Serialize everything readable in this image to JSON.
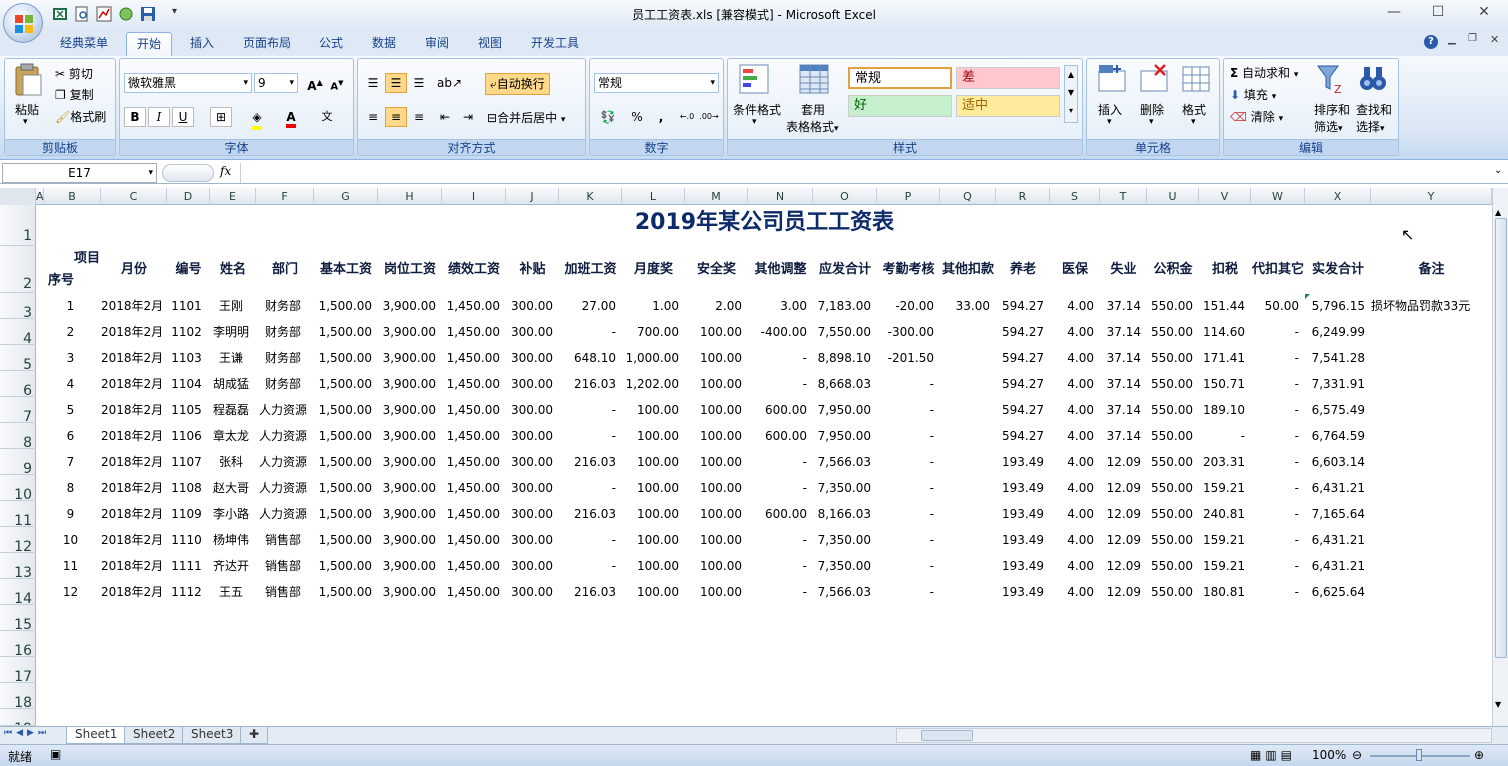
{
  "window": {
    "title": "员工工资表.xls  [兼容模式] - Microsoft Excel"
  },
  "tabs": [
    "经典菜单",
    "开始",
    "插入",
    "页面布局",
    "公式",
    "数据",
    "审阅",
    "视图",
    "开发工具"
  ],
  "ribbon": {
    "clipboard": {
      "label": "剪贴板",
      "paste": "粘贴",
      "cut": "剪切",
      "copy": "复制",
      "format_painter": "格式刷"
    },
    "font": {
      "label": "字体",
      "font_name": "微软雅黑",
      "font_size": "9"
    },
    "alignment": {
      "label": "对齐方式",
      "wrap": "自动换行",
      "merge": "合并后居中"
    },
    "number": {
      "label": "数字",
      "format": "常规",
      "percent": "%",
      "comma": ","
    },
    "styles": {
      "label": "样式",
      "cond": "条件格式",
      "table_line1": "套用",
      "table_line2": "表格格式",
      "normal": "常规",
      "bad": "差",
      "good": "好",
      "neutral": "适中"
    },
    "cells": {
      "label": "单元格",
      "insert": "插入",
      "delete": "删除",
      "format": "格式"
    },
    "editing": {
      "label": "编辑",
      "autosum": "自动求和",
      "fill": "填充",
      "clear": "清除",
      "sort1": "排序和",
      "sort2": "筛选",
      "find1": "查找和",
      "find2": "选择"
    }
  },
  "formula_bar": {
    "name_box": "E17",
    "fx": "fx",
    "content": ""
  },
  "columns": [
    "A",
    "B",
    "C",
    "D",
    "E",
    "F",
    "G",
    "H",
    "I",
    "J",
    "K",
    "L",
    "M",
    "N",
    "O",
    "P",
    "Q",
    "R",
    "S",
    "T",
    "U",
    "V",
    "W",
    "X",
    "Y"
  ],
  "rows": [
    "1",
    "2",
    "3",
    "4",
    "5",
    "6",
    "7",
    "8",
    "9",
    "10",
    "11",
    "12",
    "13",
    "14",
    "15",
    "16",
    "17",
    "18",
    "19"
  ],
  "sheet": {
    "title": "2019年某公司员工工资表",
    "header_xiangmu": "项目",
    "header_xuhao": "序号",
    "headers": [
      "月份",
      "编号",
      "姓名",
      "部门",
      "基本工资",
      "岗位工资",
      "绩效工资",
      "补贴",
      "加班工资",
      "月度奖",
      "安全奖",
      "其他调整",
      "应发合计",
      "考勤考核",
      "其他扣款",
      "养老",
      "医保",
      "失业",
      "公积金",
      "扣税",
      "代扣其它",
      "实发合计",
      "备注"
    ],
    "data": [
      [
        "1",
        "2018年2月",
        "1101",
        "王刚",
        "财务部",
        "1,500.00",
        "3,900.00",
        "1,450.00",
        "300.00",
        "27.00",
        "1.00",
        "2.00",
        "3.00",
        "7,183.00",
        "-20.00",
        "33.00",
        "594.27",
        "4.00",
        "37.14",
        "550.00",
        "151.44",
        "50.00",
        "5,796.15",
        "损坏物品罚款33元"
      ],
      [
        "2",
        "2018年2月",
        "1102",
        "李明明",
        "财务部",
        "1,500.00",
        "3,900.00",
        "1,450.00",
        "300.00",
        "-",
        "700.00",
        "100.00",
        "-400.00",
        "7,550.00",
        "-300.00",
        "",
        "594.27",
        "4.00",
        "37.14",
        "550.00",
        "114.60",
        "-",
        "6,249.99",
        ""
      ],
      [
        "3",
        "2018年2月",
        "1103",
        "王谦",
        "财务部",
        "1,500.00",
        "3,900.00",
        "1,450.00",
        "300.00",
        "648.10",
        "1,000.00",
        "100.00",
        "-",
        "8,898.10",
        "-201.50",
        "",
        "594.27",
        "4.00",
        "37.14",
        "550.00",
        "171.41",
        "-",
        "7,541.28",
        ""
      ],
      [
        "4",
        "2018年2月",
        "1104",
        "胡成猛",
        "财务部",
        "1,500.00",
        "3,900.00",
        "1,450.00",
        "300.00",
        "216.03",
        "1,202.00",
        "100.00",
        "-",
        "8,668.03",
        "-",
        "",
        "594.27",
        "4.00",
        "37.14",
        "550.00",
        "150.71",
        "-",
        "7,331.91",
        ""
      ],
      [
        "5",
        "2018年2月",
        "1105",
        "程磊磊",
        "人力资源",
        "1,500.00",
        "3,900.00",
        "1,450.00",
        "300.00",
        "-",
        "100.00",
        "100.00",
        "600.00",
        "7,950.00",
        "-",
        "",
        "594.27",
        "4.00",
        "37.14",
        "550.00",
        "189.10",
        "-",
        "6,575.49",
        ""
      ],
      [
        "6",
        "2018年2月",
        "1106",
        "章太龙",
        "人力资源",
        "1,500.00",
        "3,900.00",
        "1,450.00",
        "300.00",
        "-",
        "100.00",
        "100.00",
        "600.00",
        "7,950.00",
        "-",
        "",
        "594.27",
        "4.00",
        "37.14",
        "550.00",
        "-",
        "-",
        "6,764.59",
        ""
      ],
      [
        "7",
        "2018年2月",
        "1107",
        "张科",
        "人力资源",
        "1,500.00",
        "3,900.00",
        "1,450.00",
        "300.00",
        "216.03",
        "100.00",
        "100.00",
        "-",
        "7,566.03",
        "-",
        "",
        "193.49",
        "4.00",
        "12.09",
        "550.00",
        "203.31",
        "-",
        "6,603.14",
        ""
      ],
      [
        "8",
        "2018年2月",
        "1108",
        "赵大哥",
        "人力资源",
        "1,500.00",
        "3,900.00",
        "1,450.00",
        "300.00",
        "-",
        "100.00",
        "100.00",
        "-",
        "7,350.00",
        "-",
        "",
        "193.49",
        "4.00",
        "12.09",
        "550.00",
        "159.21",
        "-",
        "6,431.21",
        ""
      ],
      [
        "9",
        "2018年2月",
        "1109",
        "李小路",
        "人力资源",
        "1,500.00",
        "3,900.00",
        "1,450.00",
        "300.00",
        "216.03",
        "100.00",
        "100.00",
        "600.00",
        "8,166.03",
        "-",
        "",
        "193.49",
        "4.00",
        "12.09",
        "550.00",
        "240.81",
        "-",
        "7,165.64",
        ""
      ],
      [
        "10",
        "2018年2月",
        "1110",
        "杨坤伟",
        "销售部",
        "1,500.00",
        "3,900.00",
        "1,450.00",
        "300.00",
        "-",
        "100.00",
        "100.00",
        "-",
        "7,350.00",
        "-",
        "",
        "193.49",
        "4.00",
        "12.09",
        "550.00",
        "159.21",
        "-",
        "6,431.21",
        ""
      ],
      [
        "11",
        "2018年2月",
        "1111",
        "齐达开",
        "销售部",
        "1,500.00",
        "3,900.00",
        "1,450.00",
        "300.00",
        "-",
        "100.00",
        "100.00",
        "-",
        "7,350.00",
        "-",
        "",
        "193.49",
        "4.00",
        "12.09",
        "550.00",
        "159.21",
        "-",
        "6,431.21",
        ""
      ],
      [
        "12",
        "2018年2月",
        "1112",
        "王五",
        "销售部",
        "1,500.00",
        "3,900.00",
        "1,450.00",
        "300.00",
        "216.03",
        "100.00",
        "100.00",
        "-",
        "7,566.03",
        "-",
        "",
        "193.49",
        "4.00",
        "12.09",
        "550.00",
        "180.81",
        "-",
        "6,625.64",
        ""
      ]
    ]
  },
  "sheet_tabs": [
    "Sheet1",
    "Sheet2",
    "Sheet3"
  ],
  "status": {
    "ready": "就绪",
    "zoom": "100%"
  },
  "colors": {
    "accent": "#15428b",
    "title": "#0d2a6b",
    "bad_bg": "#ffc7ce",
    "good_bg": "#c6efce",
    "neutral_bg": "#ffeb9c"
  }
}
